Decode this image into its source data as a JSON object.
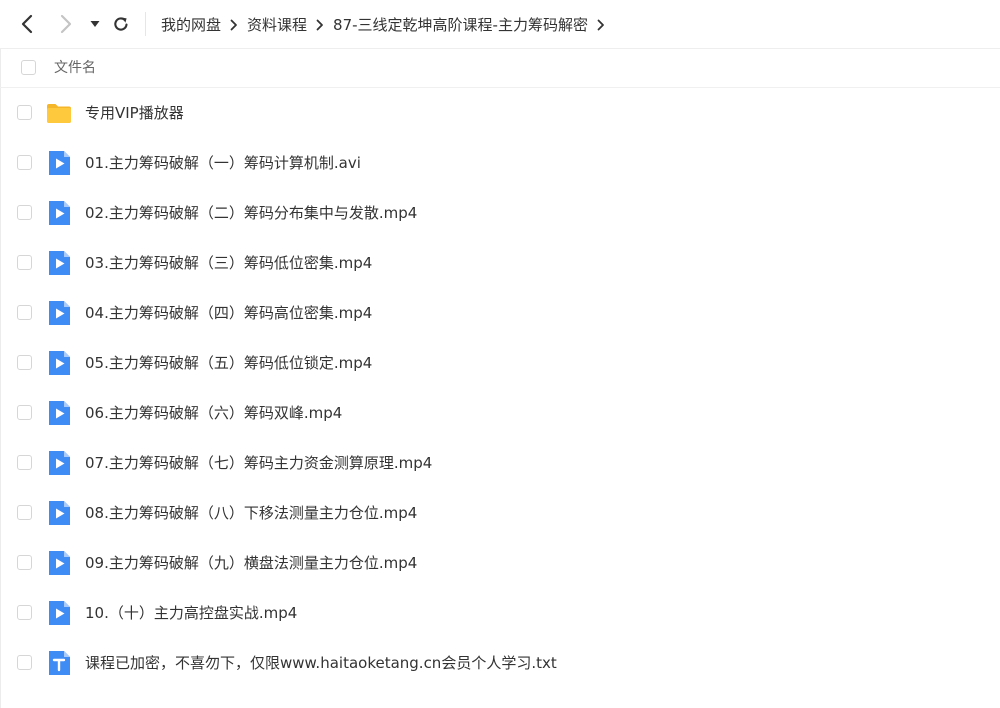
{
  "breadcrumb": [
    "我的网盘",
    "资料课程",
    "87-三线定乾坤高阶课程-主力筹码解密"
  ],
  "list_header": {
    "name_label": "文件名"
  },
  "files": [
    {
      "name": "专用VIP播放器",
      "icon": "folder-icon"
    },
    {
      "name": "01.主力筹码破解（一）筹码计算机制.avi",
      "icon": "video-file-icon"
    },
    {
      "name": "02.主力筹码破解（二）筹码分布集中与发散.mp4",
      "icon": "video-file-icon"
    },
    {
      "name": "03.主力筹码破解（三）筹码低位密集.mp4",
      "icon": "video-file-icon"
    },
    {
      "name": "04.主力筹码破解（四）筹码高位密集.mp4",
      "icon": "video-file-icon"
    },
    {
      "name": "05.主力筹码破解（五）筹码低位锁定.mp4",
      "icon": "video-file-icon"
    },
    {
      "name": "06.主力筹码破解（六）筹码双峰.mp4",
      "icon": "video-file-icon"
    },
    {
      "name": "07.主力筹码破解（七）筹码主力资金测算原理.mp4",
      "icon": "video-file-icon"
    },
    {
      "name": "08.主力筹码破解（八）下移法测量主力仓位.mp4",
      "icon": "video-file-icon"
    },
    {
      "name": "09.主力筹码破解（九）横盘法测量主力仓位.mp4",
      "icon": "video-file-icon"
    },
    {
      "name": "10.（十）主力高控盘实战.mp4",
      "icon": "video-file-icon"
    },
    {
      "name": "课程已加密，不喜勿下，仅限www.haitaoketang.cn会员个人学习.txt",
      "icon": "text-file-icon"
    }
  ],
  "colors": {
    "accent_blue": "#3f8cf5",
    "folder_yellow": "#ffc93d",
    "text": "#333333"
  }
}
